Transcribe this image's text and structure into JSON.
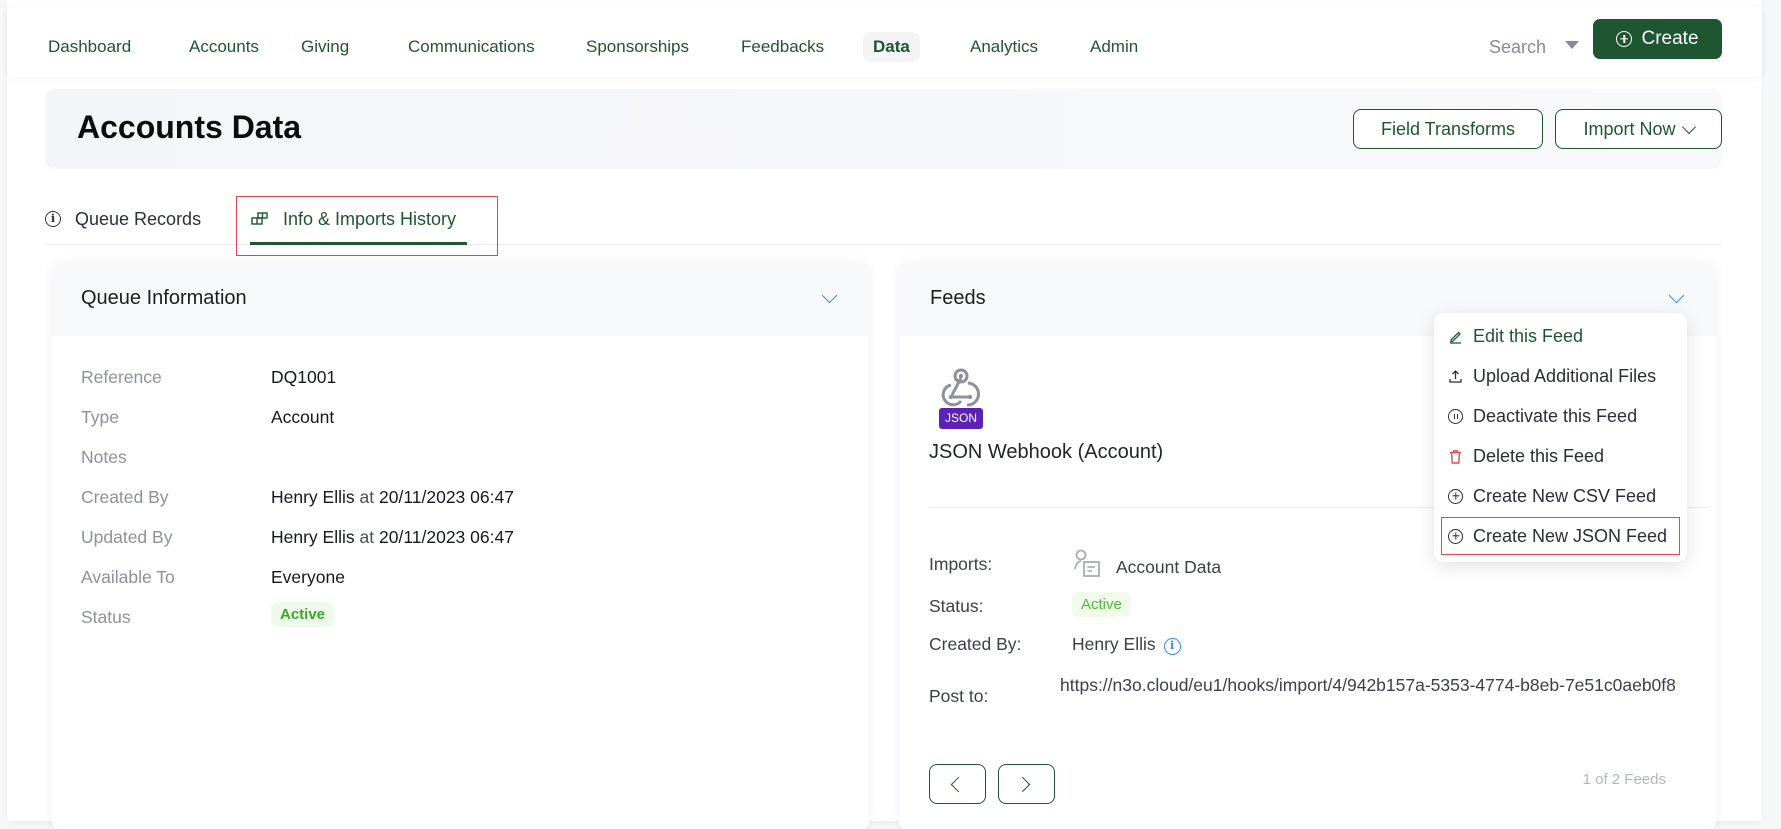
{
  "nav": {
    "items": [
      {
        "label": "Dashboard",
        "active": false
      },
      {
        "label": "Accounts",
        "active": false
      },
      {
        "label": "Giving",
        "active": false
      },
      {
        "label": "Communications",
        "active": false
      },
      {
        "label": "Sponsorships",
        "active": false
      },
      {
        "label": "Feedbacks",
        "active": false
      },
      {
        "label": "Data",
        "active": true
      },
      {
        "label": "Analytics",
        "active": false
      },
      {
        "label": "Admin",
        "active": false
      }
    ],
    "search_label": "Search",
    "create_label": "Create",
    "accent_color": "#1e5631"
  },
  "header": {
    "title": "Accounts Data",
    "field_transforms_label": "Field Transforms",
    "import_now_label": "Import Now"
  },
  "tabs": [
    {
      "label": "Queue Records",
      "icon": "info-icon",
      "active": false
    },
    {
      "label": "Info & Imports History",
      "icon": "grid-icon",
      "active": true
    }
  ],
  "queue_info": {
    "title": "Queue Information",
    "rows": [
      {
        "label": "Reference",
        "value": "DQ1001"
      },
      {
        "label": "Type",
        "value": "Account"
      },
      {
        "label": "Notes",
        "value": ""
      },
      {
        "label": "Created By",
        "user": "Henry Ellis",
        "connector": "at",
        "datetime": "20/11/2023 06:47"
      },
      {
        "label": "Updated By",
        "user": "Henry Ellis",
        "connector": "at",
        "datetime": "20/11/2023 06:47"
      },
      {
        "label": "Available To",
        "value": "Everyone"
      },
      {
        "label": "Status",
        "value": "Active"
      }
    ]
  },
  "feeds": {
    "title": "Feeds",
    "badge": "JSON",
    "feed_name": "JSON Webhook (Account)",
    "imports_label": "Imports:",
    "imports_value": "Account Data",
    "status_label": "Status:",
    "status_value": "Active",
    "created_by_label": "Created By:",
    "created_by_value": "Henry Ellis",
    "post_to_label": "Post to:",
    "post_to_value": "https://n3o.cloud/eu1/hooks/import/4/942b157a-5353-4774-b8eb-7e51c0aeb0f8",
    "pager": {
      "current": 1,
      "total": 2,
      "text": "1 of 2 Feeds"
    }
  },
  "feed_menu": {
    "items": [
      {
        "label": "Edit this Feed",
        "icon": "pencil-icon"
      },
      {
        "label": "Upload Additional Files",
        "icon": "upload-icon"
      },
      {
        "label": "Deactivate this Feed",
        "icon": "pause-icon"
      },
      {
        "label": "Delete this Feed",
        "icon": "trash-icon"
      },
      {
        "label": "Create New CSV Feed",
        "icon": "plus-circle-icon"
      },
      {
        "label": "Create New JSON Feed",
        "icon": "plus-circle-icon"
      }
    ]
  }
}
